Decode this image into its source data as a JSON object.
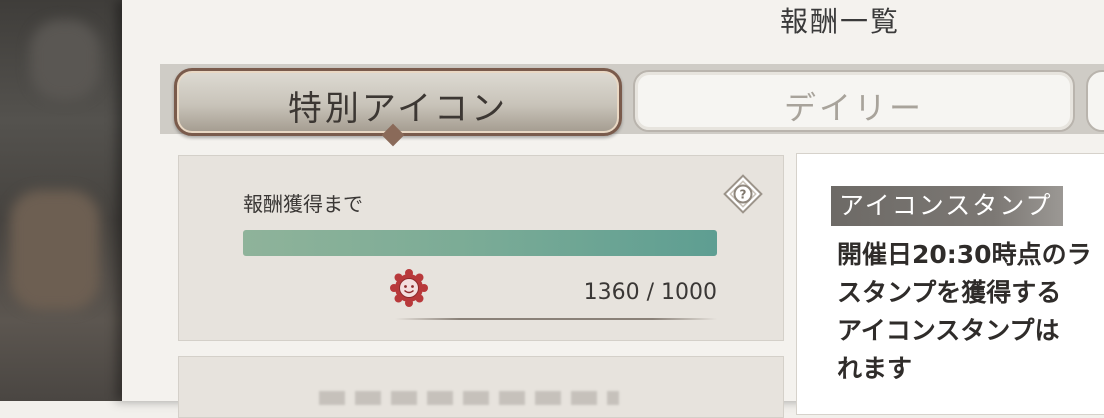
{
  "header": {
    "title": "報酬一覧"
  },
  "tabs": [
    {
      "label": "特別アイコン",
      "active": true
    },
    {
      "label": "デイリー",
      "active": false
    }
  ],
  "progress_card": {
    "label": "報酬獲得まで",
    "progress_fraction": 1.0,
    "count_text": "1360 / 1000",
    "help_icon": "question-diamond-icon",
    "reward_icon": "red-flower-medal-icon"
  },
  "description_card": {
    "heading": "アイコンスタンプ",
    "lines": [
      "開催日20:30時点のラ",
      "スタンプを獲得する",
      "アイコンスタンプは",
      "れます"
    ]
  },
  "colors": {
    "bar_fill_start": "#8fb39a",
    "bar_fill_end": "#5e9e92",
    "active_tab_border": "#7a5b4c",
    "heading_bg": "#6d6a66"
  }
}
